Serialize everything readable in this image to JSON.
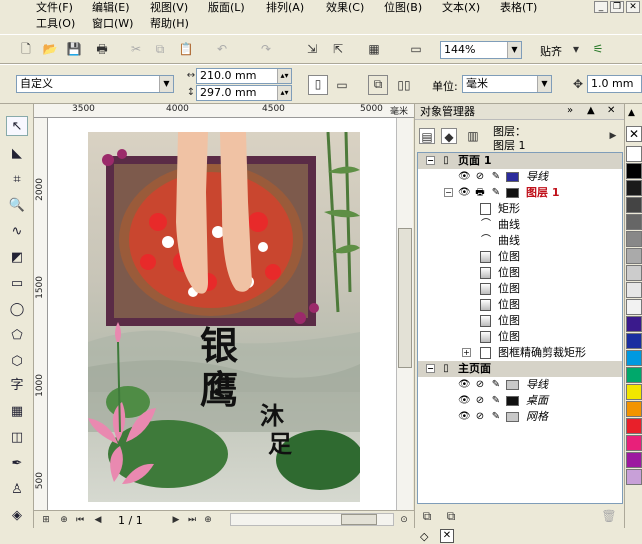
{
  "menubar": {
    "row1": [
      "文件(F)",
      "编辑(E)",
      "视图(V)",
      "版面(L)",
      "排列(A)",
      "效果(C)",
      "位图(B)",
      "文本(X)",
      "表格(T)"
    ],
    "row2": [
      "工具(O)",
      "窗口(W)",
      "帮助(H)"
    ]
  },
  "toolbar": {
    "zoom": "144%",
    "snap_label": "贴齐"
  },
  "propbar": {
    "paper": "自定义",
    "width": "210.0 mm",
    "height": "297.0 mm",
    "unit_label": "单位:",
    "unit": "毫米",
    "nudge": "1.0 mm"
  },
  "ruler": {
    "h_ticks": [
      "3500",
      "4000",
      "4500",
      "5000"
    ],
    "h_unit": "毫米",
    "v_ticks": [
      "2000",
      "1500",
      "1000",
      "500"
    ]
  },
  "poster": {
    "title_line1": "银",
    "title_line2": "鹰",
    "sub1": "沐",
    "sub2": "足"
  },
  "pagenav": {
    "page": "1 / 1"
  },
  "object_manager": {
    "title": "对象管理器",
    "layer_label": "图层：",
    "layer_name": "图层 1",
    "rows": [
      {
        "type": "page",
        "label": "页面 1"
      },
      {
        "type": "layer",
        "label": "导线",
        "color": "#2b2b9c"
      },
      {
        "type": "layer-active",
        "label": "图层 1",
        "color": "#111111"
      },
      {
        "type": "obj",
        "label": "矩形",
        "icon": "rect"
      },
      {
        "type": "obj",
        "label": "曲线",
        "icon": "curve"
      },
      {
        "type": "obj",
        "label": "曲线",
        "icon": "curve"
      },
      {
        "type": "obj",
        "label": "位图",
        "icon": "bitmap"
      },
      {
        "type": "obj",
        "label": "位图",
        "icon": "bitmap"
      },
      {
        "type": "obj",
        "label": "位图",
        "icon": "bitmap"
      },
      {
        "type": "obj",
        "label": "位图",
        "icon": "bitmap"
      },
      {
        "type": "obj",
        "label": "位图",
        "icon": "bitmap"
      },
      {
        "type": "obj",
        "label": "位图",
        "icon": "bitmap"
      },
      {
        "type": "obj",
        "label": "图框精确剪裁矩形",
        "icon": "powerclip"
      },
      {
        "type": "page",
        "label": "主页面"
      },
      {
        "type": "layer",
        "label": "导线",
        "color": "#c8c8c8"
      },
      {
        "type": "layer",
        "label": "桌面",
        "color": "#111111"
      },
      {
        "type": "layer",
        "label": "网格",
        "color": "#c8c8c8"
      }
    ]
  },
  "palette": [
    "#ffffff",
    "#000000",
    "#1a1a1a",
    "#444444",
    "#666666",
    "#888888",
    "#aaaaaa",
    "#cccccc",
    "#e6e6e6",
    "#f2f2f2",
    "#3a1a8c",
    "#1a2ea0",
    "#0099e0",
    "#00a86b",
    "#f2e600",
    "#f29400",
    "#e8202a",
    "#e8207a",
    "#9c1aa0",
    "#c8a0d8"
  ]
}
